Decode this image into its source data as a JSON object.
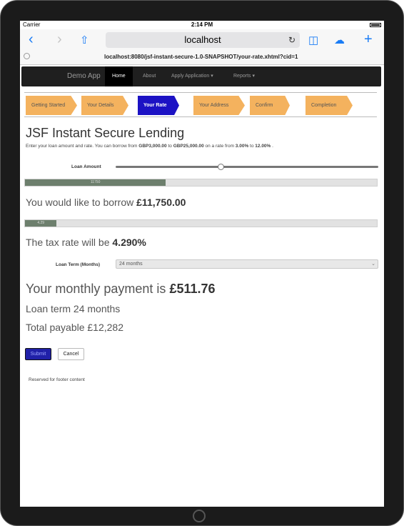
{
  "status_bar": {
    "carrier": "Carrier",
    "time": "2:14 PM",
    "battery_pct": 0.9
  },
  "browser": {
    "host": "localhost",
    "url": "localhost:8080/jsf-instant-secure-1.0-SNAPSHOT/your-rate.xhtml?cid=1"
  },
  "navbar": {
    "brand": "Demo App",
    "items": [
      "Home",
      "About",
      "Apply Application ▾",
      "Reports ▾"
    ]
  },
  "steps": [
    "Getting Started",
    "Your Details",
    "Your Rate",
    "Your Address",
    "Confirm",
    "Completion"
  ],
  "active_step": 2,
  "content": {
    "title": "JSF Instant Secure Lending",
    "intro_pre": "Enter your loan amount and rate. You can borrow from ",
    "min_amount": "GBP3,000.00",
    "intro_to1": " to ",
    "max_amount": "GBP25,000.00",
    "intro_mid": " on a rate from ",
    "min_rate": "3.00%",
    "intro_to2": " to ",
    "max_rate": "12.00%",
    "intro_end": " .",
    "loan_amount_label": "Loan Amount",
    "loan_slider_value": 0.4,
    "borrow_progress_label": "11750",
    "borrow_progress_value": 0.4,
    "borrow_text": "You would like to borrow ",
    "borrow_amount": "£11,750.00",
    "rate_progress_label": "4.29",
    "rate_progress_value": 0.09,
    "tax_text": "The tax rate will be ",
    "tax_rate": "4.290%",
    "loan_term_label": "Loan Term (Months)",
    "loan_term_selected": "24 months",
    "monthly_text": "Your monthly payment is ",
    "monthly_amount": "£511.76",
    "loan_term_text": "Loan term 24 months",
    "total_payable_text": "Total payable £12,282",
    "submit_label": "Submit",
    "cancel_label": "Cancel",
    "footer": "Reserved for footer content"
  },
  "colors": {
    "active_step": "#1c12c4",
    "inactive_step": "#f4b25e",
    "ios_blue": "#1a7cf5",
    "navbar": "#1f1f1f"
  }
}
